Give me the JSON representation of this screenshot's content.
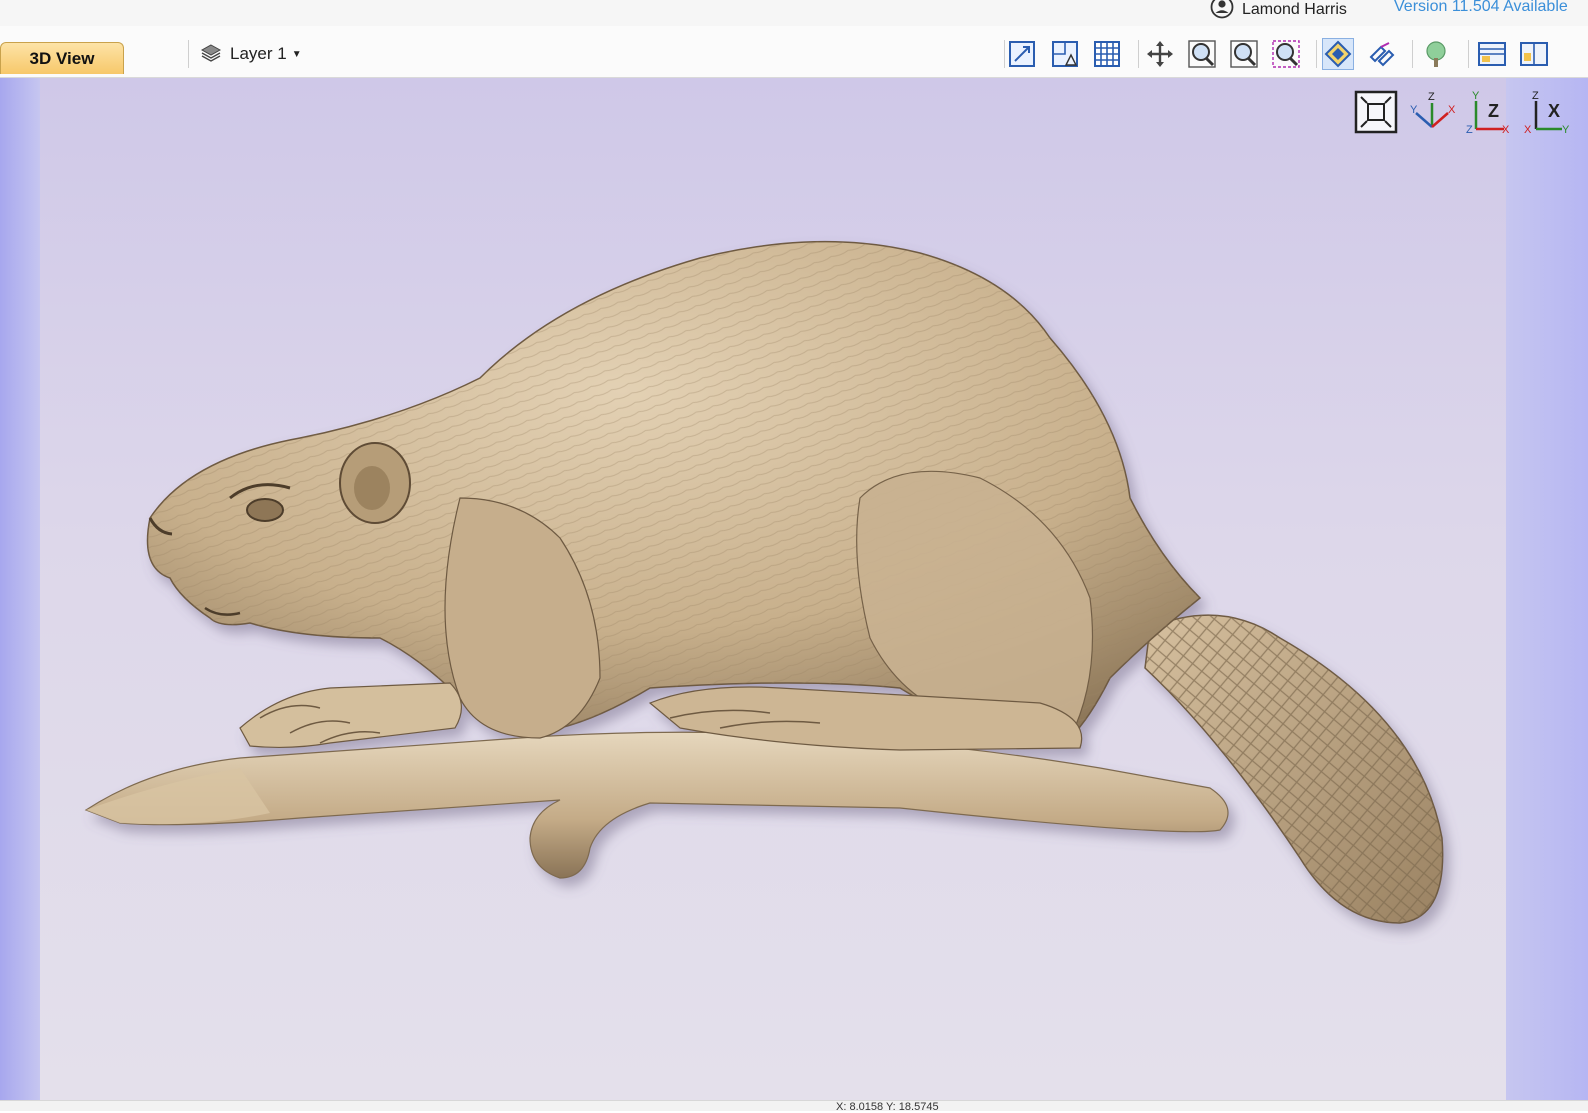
{
  "topbar": {
    "user_name": "Lamond Harris",
    "version_notice": "Version 11.504 Available",
    "user_icon": "user-circle-icon"
  },
  "toolbar": {
    "tab_label": "3D View",
    "layer_label": "Layer 1",
    "layer_icon": "layer-stack-icon",
    "buttons": [
      "fit-to-size-icon",
      "show-2d-view-icon",
      "toggle-grid-icon",
      "pan-icon",
      "zoom-in-icon",
      "zoom-out-icon",
      "zoom-selection-icon",
      "render-shaded-icon",
      "render-toolpath-icon",
      "tree-icon",
      "layout-split-horizontal-icon",
      "layout-split-vertical-icon"
    ]
  },
  "viewport": {
    "model_name": "beaver-relief-model",
    "view_controls": [
      "zoom-extents-icon",
      "iso-view-icon",
      "view-front-icon",
      "view-side-icon"
    ],
    "axis_labels": {
      "x": "X",
      "y": "Y",
      "z": "Z"
    },
    "accent_model": "#c9b392",
    "background_top": "#cfc8e8",
    "background_bottom": "#e4e0eb"
  },
  "statusbar": {
    "coords_text": "X: 8.0158 Y: 18.5745"
  }
}
